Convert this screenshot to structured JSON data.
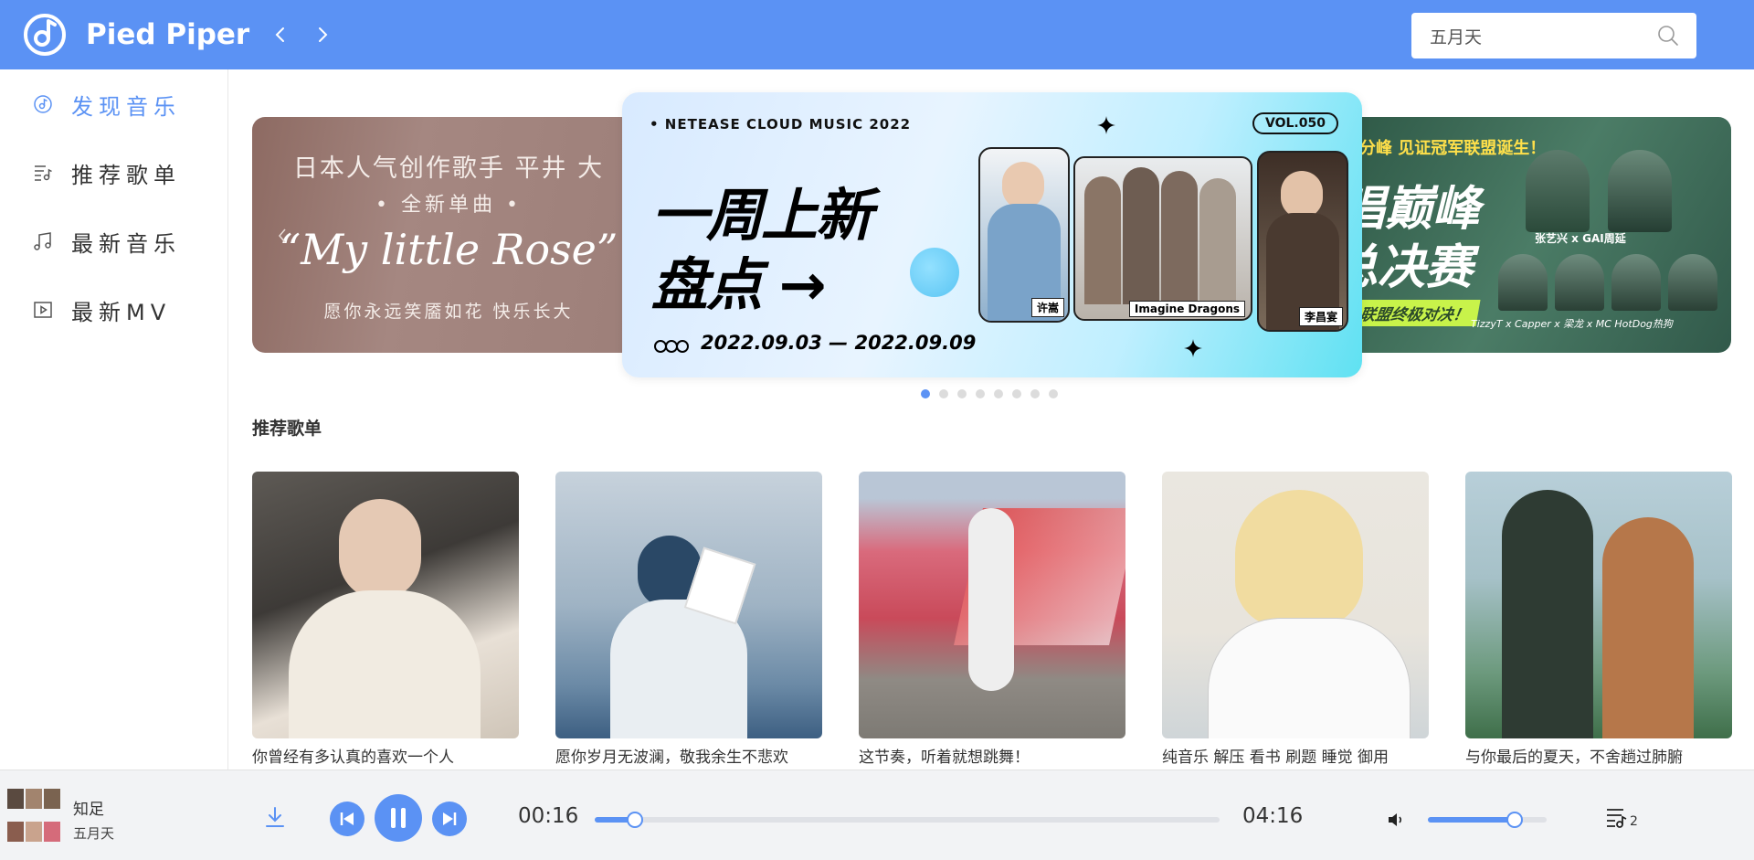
{
  "app": {
    "name": "Pied Piper",
    "accent": "#5b92f4"
  },
  "header": {
    "back_icon": "chevron-left-icon",
    "forward_icon": "chevron-right-icon",
    "search": {
      "value": "五月天",
      "icon": "search-icon"
    }
  },
  "sidebar": {
    "items": [
      {
        "label": "发现音乐",
        "icon": "disc-icon",
        "active": true
      },
      {
        "label": "推荐歌单",
        "icon": "playlist-icon",
        "active": false
      },
      {
        "label": "最新音乐",
        "icon": "music-note-icon",
        "active": false
      },
      {
        "label": "最新MV",
        "icon": "video-icon",
        "active": false
      }
    ]
  },
  "banner": {
    "left": {
      "line1": "日本人气创作歌手 平井 大",
      "line2": "• 全新单曲 •",
      "line3": "“My little Rose”",
      "line4": "愿你永远笑靥如花 快乐长大"
    },
    "center": {
      "brand": "• NETEASE CLOUD MUSIC 2022",
      "vol": "VOL.050",
      "title1": "一周上新",
      "title2": "盘点 →",
      "dates": "2022.09.03 — 2022.09.09",
      "artists": [
        "许嵩",
        "Imagine Dragons",
        "李昌宴"
      ]
    },
    "right": {
      "top": "村分峰   见证冠军联盟诞生！",
      "title1": "唱巅峰",
      "title2": "总决赛",
      "tag": "大联盟终极对决！",
      "caption1": "张艺兴 x GAI周延",
      "caption2": "TizzyT x Capper x 梁龙 x MC HotDog热狗"
    },
    "dots_total": 8,
    "active_index": 0
  },
  "section": {
    "title": "推荐歌单"
  },
  "playlists": [
    {
      "name": "你曾经有多认真的喜欢一个人"
    },
    {
      "name": "愿你岁月无波澜，敬我余生不悲欢"
    },
    {
      "name": "这节奏，听着就想跳舞！"
    },
    {
      "name": "纯音乐 解压 看书 刷题 睡觉 御用"
    },
    {
      "name": "与你最后的夏天，不舍趟过肺腑"
    }
  ],
  "player": {
    "song": "知足",
    "artist": "五月天",
    "current_time": "00:16",
    "total_time": "04:16",
    "progress": 0.0625,
    "volume": 0.72,
    "playlist_count": "2",
    "icons": [
      "download-icon",
      "previous-icon",
      "pause-icon",
      "next-icon",
      "volume-icon",
      "playlist-queue-icon"
    ]
  }
}
